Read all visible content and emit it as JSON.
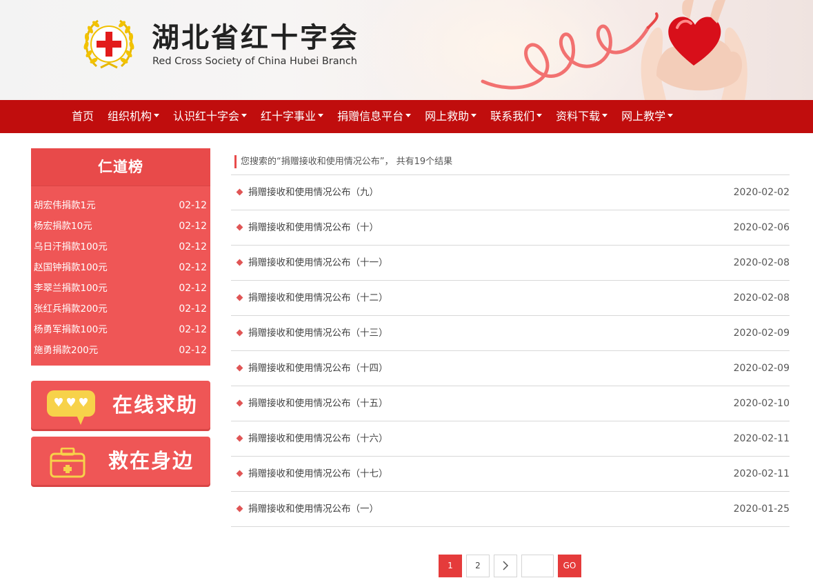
{
  "header": {
    "title_cn": "湖北省红十字会",
    "title_en": "Red Cross Society of China Hubei Branch",
    "emblem_icon": "red-cross-emblem-icon",
    "accent": "#c00d0d"
  },
  "nav": {
    "items": [
      {
        "label": "首页",
        "dropdown": false
      },
      {
        "label": "组织机构",
        "dropdown": true
      },
      {
        "label": "认识红十字会",
        "dropdown": true
      },
      {
        "label": "红十字事业",
        "dropdown": true
      },
      {
        "label": "捐赠信息平台",
        "dropdown": true
      },
      {
        "label": "网上救助",
        "dropdown": true
      },
      {
        "label": "联系我们",
        "dropdown": true
      },
      {
        "label": "资料下载",
        "dropdown": true
      },
      {
        "label": "网上教学",
        "dropdown": true
      }
    ]
  },
  "sidebar": {
    "rank_title": "仁道榜",
    "donors": [
      {
        "name": "胡宏伟捐款1元",
        "date": "02-12"
      },
      {
        "name": "杨宏捐款10元",
        "date": "02-12"
      },
      {
        "name": "乌日汗捐款100元",
        "date": "02-12"
      },
      {
        "name": "赵国钟捐款100元",
        "date": "02-12"
      },
      {
        "name": "李翠兰捐款100元",
        "date": "02-12"
      },
      {
        "name": "张红兵捐款200元",
        "date": "02-12"
      },
      {
        "name": "杨勇军捐款100元",
        "date": "02-12"
      },
      {
        "name": "施勇捐款200元",
        "date": "02-12"
      }
    ],
    "promo_online_help": "在线求助",
    "promo_help_nearby": "救在身边"
  },
  "search": {
    "summary": "您搜索的“捐赠接收和使用情况公布”， 共有19个结果"
  },
  "results": [
    {
      "title": "捐赠接收和使用情况公布（九）",
      "date": "2020-02-02"
    },
    {
      "title": "捐赠接收和使用情况公布（十）",
      "date": "2020-02-06"
    },
    {
      "title": "捐赠接收和使用情况公布（十一）",
      "date": "2020-02-08"
    },
    {
      "title": "捐赠接收和使用情况公布（十二）",
      "date": "2020-02-08"
    },
    {
      "title": "捐赠接收和使用情况公布（十三）",
      "date": "2020-02-09"
    },
    {
      "title": "捐赠接收和使用情况公布（十四）",
      "date": "2020-02-09"
    },
    {
      "title": "捐赠接收和使用情况公布（十五）",
      "date": "2020-02-10"
    },
    {
      "title": "捐赠接收和使用情况公布（十六）",
      "date": "2020-02-11"
    },
    {
      "title": "捐赠接收和使用情况公布（十七）",
      "date": "2020-02-11"
    },
    {
      "title": "捐赠接收和使用情况公布（一）",
      "date": "2020-01-25"
    }
  ],
  "pagination": {
    "pages": [
      "1",
      "2"
    ],
    "current": "1",
    "next_icon": "chevron-right-icon",
    "jump_value": "",
    "go_label": "GO"
  }
}
